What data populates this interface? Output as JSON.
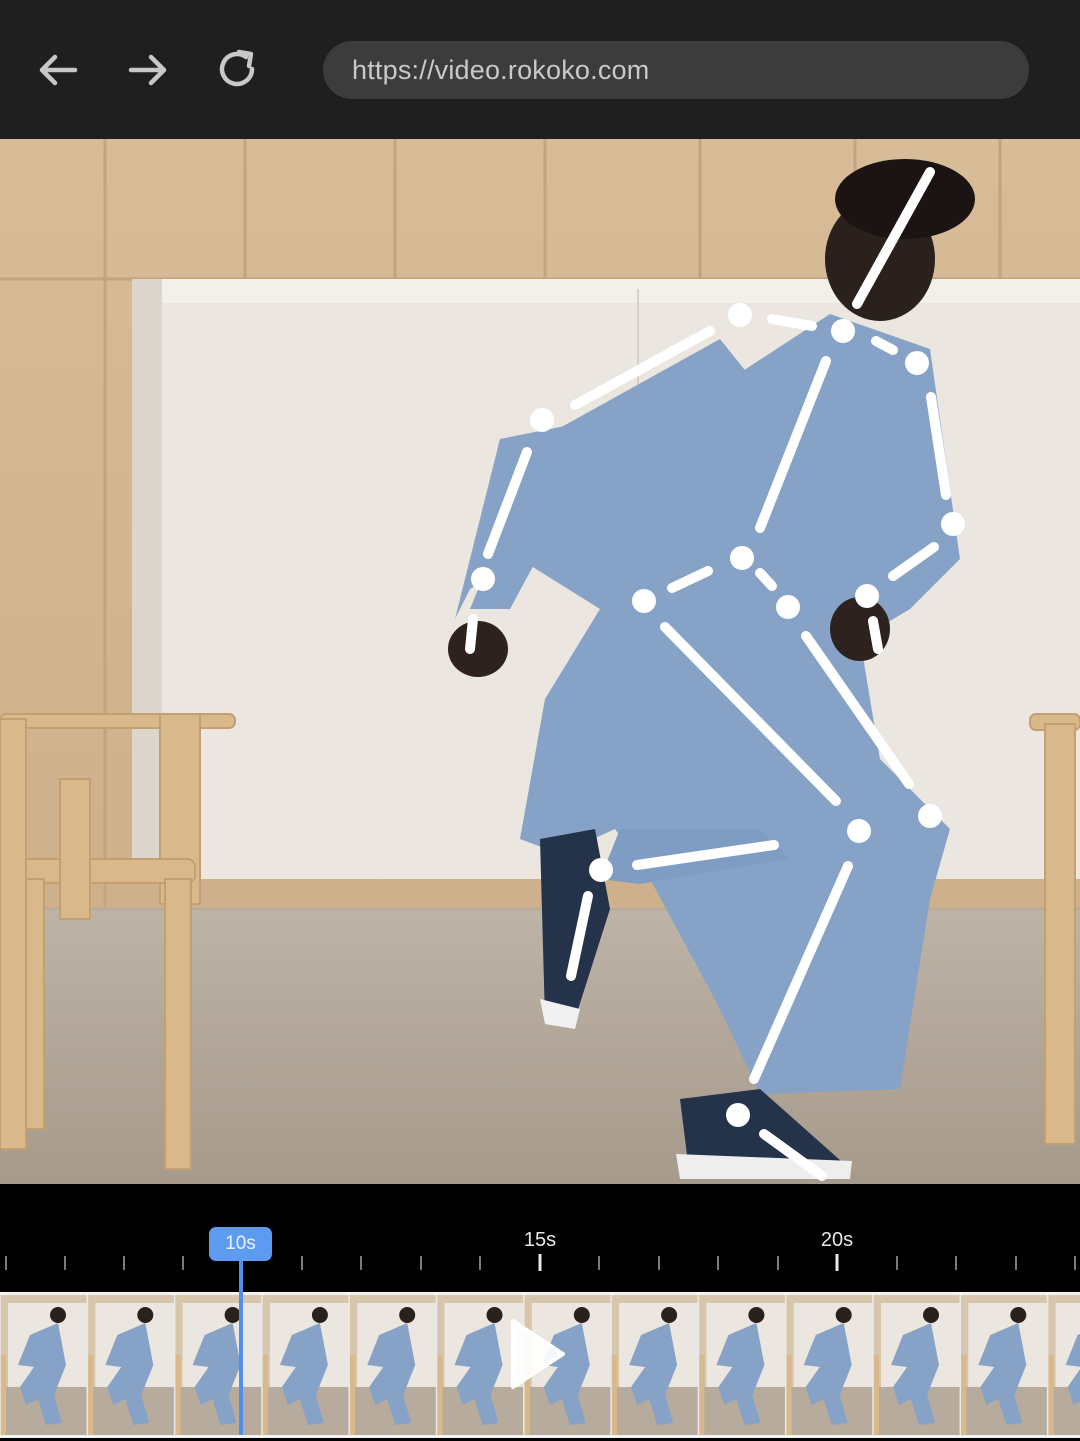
{
  "browser": {
    "url": "https://video.rokoko.com",
    "icons": {
      "back": "arrow-left-icon",
      "forward": "arrow-right-icon",
      "reload": "reload-icon"
    }
  },
  "video": {
    "description_icon": "pose-skeleton-overlay"
  },
  "timeline": {
    "current_time_label": "10s",
    "tick_labels": [
      "15s",
      "20s"
    ],
    "play_icon": "play-icon",
    "accent_color": "#5d9bf0"
  }
}
